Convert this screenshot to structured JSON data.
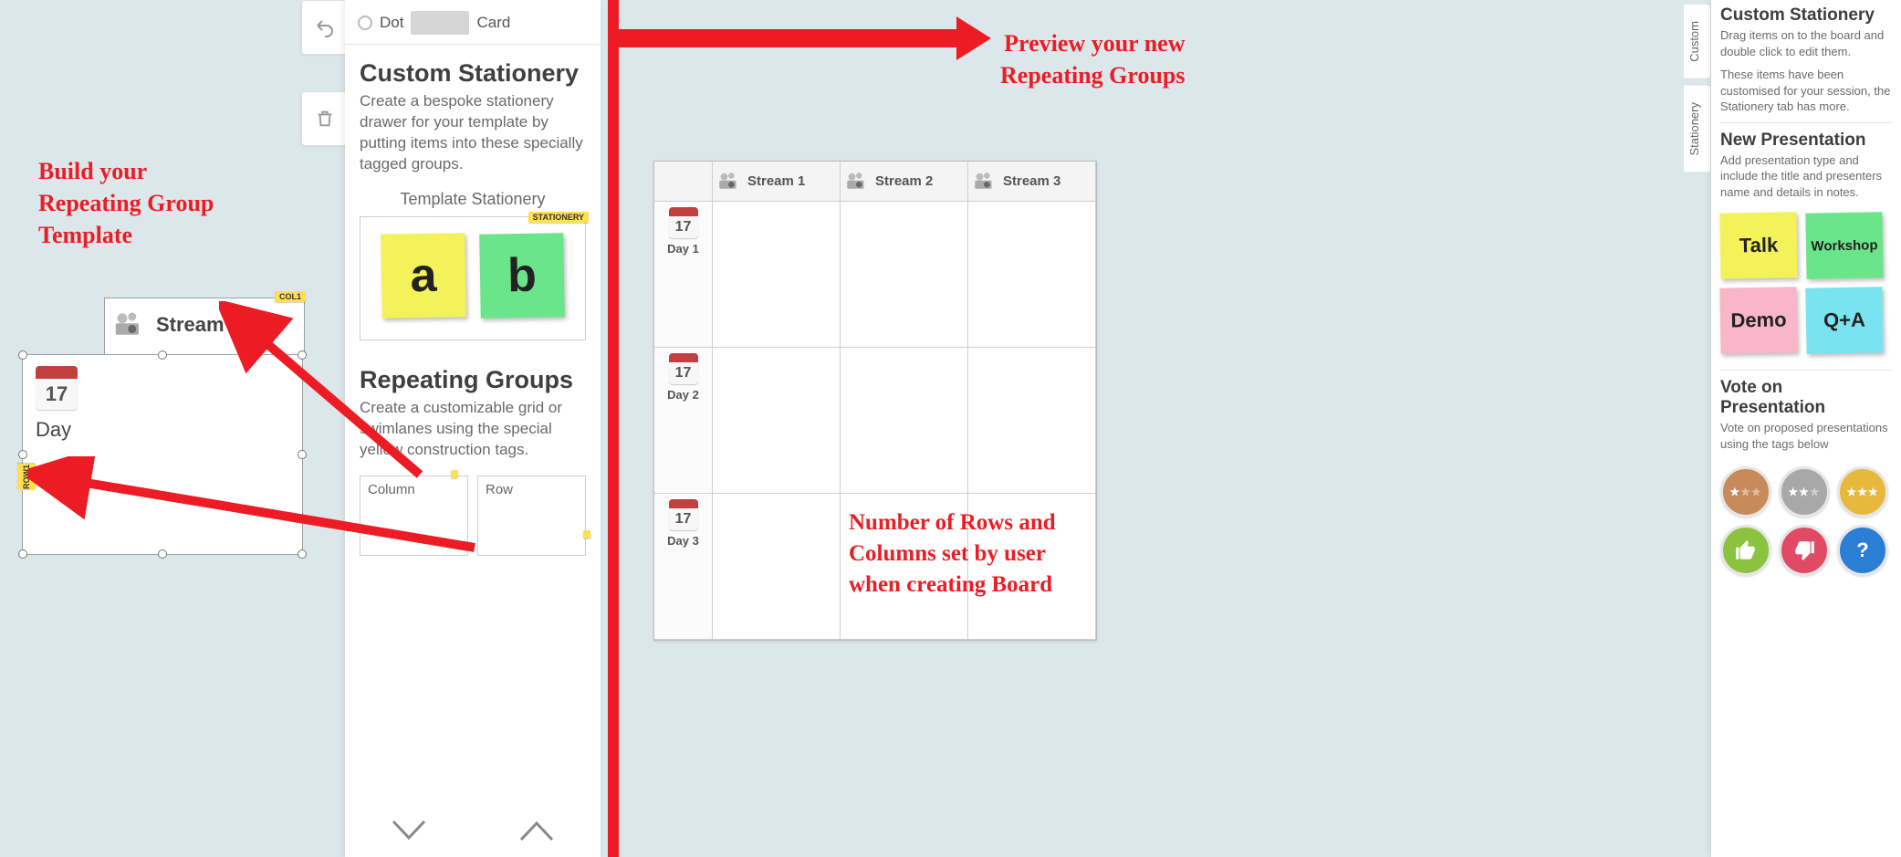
{
  "annotations": {
    "build_template": "Build your\nRepeating Group\nTemplate",
    "preview": "Preview your new\nRepeating Groups",
    "rows_cols": "Number of Rows and\nColumns set by user\nwhen creating Board"
  },
  "toolbar": {
    "undo_label": "Undo",
    "trash_label": "Delete"
  },
  "radio_row": {
    "dot_label": "Dot",
    "card_label": "Card"
  },
  "drawer": {
    "stationery_heading": "Custom Stationery",
    "stationery_desc": "Create a bespoke stationery drawer for your template by putting items into these specially tagged groups.",
    "stationery_sub": "Template Stationery",
    "stationery_tag": "STATIONERY",
    "sticky_a": "a",
    "sticky_b": "b",
    "rg_heading": "Repeating Groups",
    "rg_desc": "Create a customizable grid or swimlanes using the special yellow construction tags.",
    "rg_column": "Column",
    "rg_row": "Row"
  },
  "template_groups": {
    "col_tag": "COL1",
    "row_tag": "ROW1",
    "stream_label": "Stream",
    "day_label": "Day",
    "calendar_day": "17"
  },
  "preview": {
    "columns": [
      "Stream 1",
      "Stream 2",
      "Stream 3"
    ],
    "rows": [
      "Day 1",
      "Day 2",
      "Day 3"
    ],
    "calendar_day": "17"
  },
  "side_tabs": {
    "custom": "Custom",
    "stationery": "Stationery"
  },
  "right": {
    "cs_heading": "Custom Stationery",
    "cs_desc1": "Drag items on to the board and double click to edit them.",
    "cs_desc2": "These items have been customised for your session, the Stationery tab has more.",
    "np_heading": "New Presentation",
    "np_desc": "Add presentation type and include the title and presenters name and details in notes.",
    "sticky_talk": "Talk",
    "sticky_workshop": "Workshop",
    "sticky_demo": "Demo",
    "sticky_qa": "Q+A",
    "vote_heading": "Vote on Presentation",
    "vote_desc": "Vote on proposed presentations using the tags below"
  }
}
